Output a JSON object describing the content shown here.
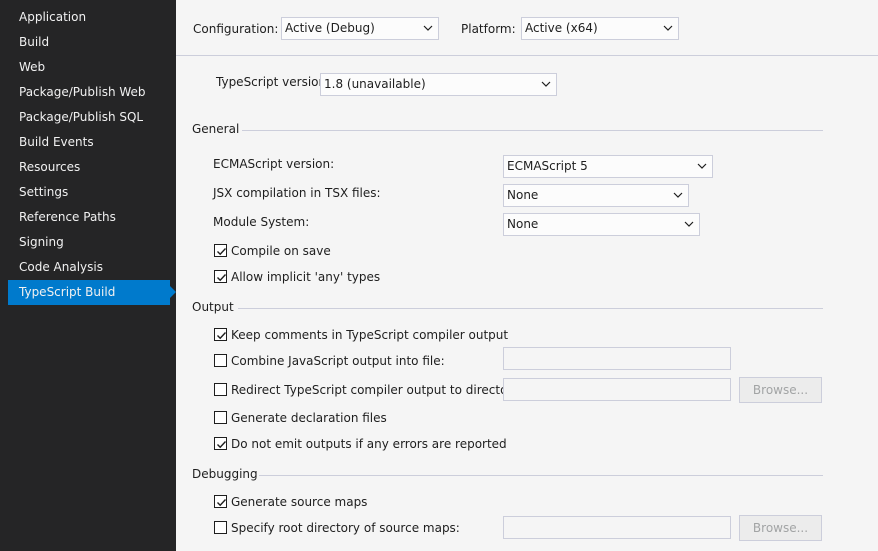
{
  "sidebar": {
    "items": [
      {
        "label": "Application"
      },
      {
        "label": "Build"
      },
      {
        "label": "Web"
      },
      {
        "label": "Package/Publish Web"
      },
      {
        "label": "Package/Publish SQL"
      },
      {
        "label": "Build Events"
      },
      {
        "label": "Resources"
      },
      {
        "label": "Settings"
      },
      {
        "label": "Reference Paths"
      },
      {
        "label": "Signing"
      },
      {
        "label": "Code Analysis"
      },
      {
        "label": "TypeScript Build"
      }
    ],
    "active_index": 11
  },
  "top": {
    "configuration_label": "Configuration:",
    "configuration_value": "Active (Debug)",
    "platform_label": "Platform:",
    "platform_value": "Active (x64)"
  },
  "ts_version": {
    "label": "TypeScript version:",
    "value": "1.8 (unavailable)"
  },
  "general": {
    "title": "General",
    "ecmascript_label": "ECMAScript version:",
    "ecmascript_value": "ECMAScript 5",
    "jsx_label": "JSX compilation in TSX files:",
    "jsx_value": "None",
    "module_label": "Module System:",
    "module_value": "None",
    "compile_on_save_label": "Compile on save",
    "compile_on_save_checked": true,
    "allow_implicit_any_label": "Allow implicit 'any' types",
    "allow_implicit_any_checked": true
  },
  "output": {
    "title": "Output",
    "keep_comments_label": "Keep comments in TypeScript compiler output",
    "keep_comments_checked": true,
    "combine_js_label": "Combine JavaScript output into file:",
    "combine_js_checked": false,
    "redirect_label": "Redirect TypeScript compiler output to directory:",
    "redirect_checked": false,
    "browse_label": "Browse...",
    "generate_decl_label": "Generate declaration files",
    "generate_decl_checked": false,
    "no_emit_label": "Do not emit outputs if any errors are reported",
    "no_emit_checked": true
  },
  "debugging": {
    "title": "Debugging",
    "source_maps_label": "Generate source maps",
    "source_maps_checked": true,
    "root_dir_label": "Specify root directory of source maps:",
    "root_dir_checked": false,
    "browse_label": "Browse..."
  },
  "colors": {
    "sidebar_bg": "#252526",
    "active_item": "#007acc",
    "panel_bg": "#f5f5f5"
  }
}
